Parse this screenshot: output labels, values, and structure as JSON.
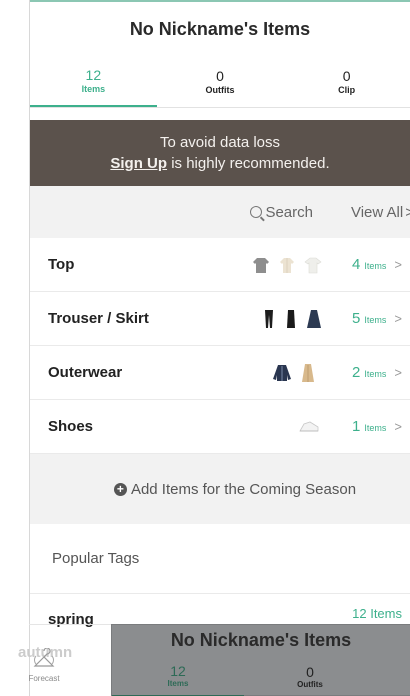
{
  "header": {
    "title": "No Nickname's Items"
  },
  "stats": [
    {
      "value": "12",
      "label": "Items",
      "active": true
    },
    {
      "value": "0",
      "label": "Outfits",
      "active": false
    },
    {
      "value": "0",
      "label": "Clip",
      "active": false
    }
  ],
  "banner": {
    "line1": "To avoid data loss",
    "signup": "Sign Up",
    "line2_rest": " is highly recommended."
  },
  "search": {
    "label": "Search",
    "view_all": "View All",
    "chevron": ">"
  },
  "categories": [
    {
      "name": "Top",
      "count": "4",
      "unit": "Items"
    },
    {
      "name": "Trouser / Skirt",
      "count": "5",
      "unit": "Items"
    },
    {
      "name": "Outerwear",
      "count": "2",
      "unit": "Items"
    },
    {
      "name": "Shoes",
      "count": "1",
      "unit": "Items"
    }
  ],
  "add_items": {
    "label": "Add Items for the Coming Season"
  },
  "popular_tags": {
    "heading": "Popular Tags",
    "tags": [
      {
        "name": "spring",
        "count": "12 Items"
      },
      {
        "name": "autumn"
      }
    ]
  },
  "bottom_nav": {
    "forecast": "Forecast"
  },
  "overlay": {
    "title": "No Nickname's Items",
    "stats": [
      {
        "value": "12",
        "label": "Items"
      },
      {
        "value": "0",
        "label": "Outfits"
      }
    ]
  },
  "colors": {
    "accent": "#3db08c",
    "banner_bg": "#5b524c",
    "overlay_bg": "#8b8d8f"
  }
}
